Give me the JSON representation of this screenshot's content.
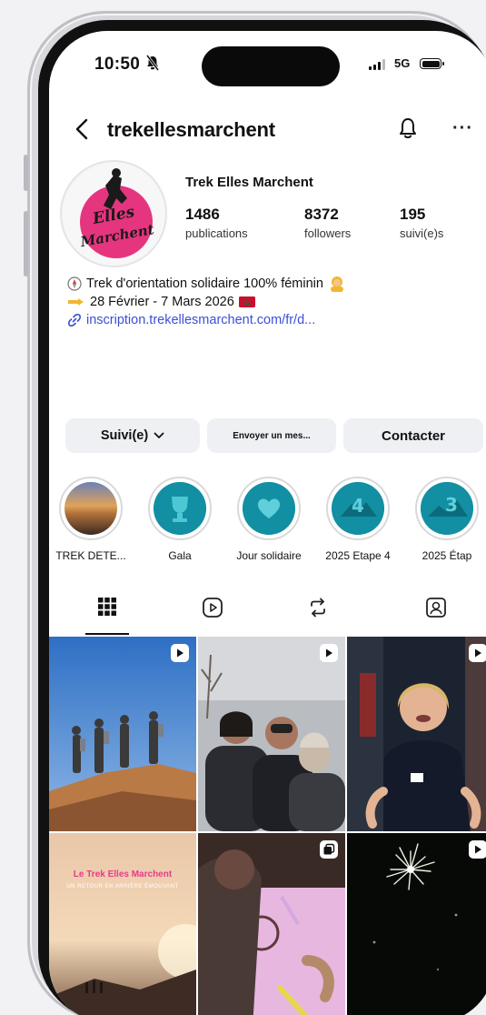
{
  "status_bar": {
    "time": "10:50",
    "network": "5G"
  },
  "header": {
    "username": "trekellesmarchent"
  },
  "profile": {
    "display_name": "Trek Elles Marchent",
    "avatar_text": "Elles Marchent",
    "stats": [
      {
        "value": "1486",
        "label": "publications"
      },
      {
        "value": "8372",
        "label": "followers"
      },
      {
        "value": "195",
        "label": "suivi(e)s"
      }
    ],
    "bio": {
      "line1": "Trek d'orientation solidaire 100% féminin",
      "line2": "28 Février - 7 Mars 2026",
      "link": "inscription.trekellesmarchent.com/fr/d..."
    }
  },
  "actions": {
    "follow": "Suivi(e)",
    "message": "Envoyer un mes...",
    "contact": "Contacter"
  },
  "highlights": [
    {
      "label": "TREK DETE..."
    },
    {
      "label": "Gala"
    },
    {
      "label": "Jour solidaire"
    },
    {
      "label": "2025 Etape 4"
    },
    {
      "label": "2025 Étap"
    }
  ],
  "tabs": [
    {
      "name": "grid-icon"
    },
    {
      "name": "reels-icon"
    },
    {
      "name": "reposts-icon"
    },
    {
      "name": "tagged-icon"
    }
  ],
  "grid": [
    {
      "name": "post-desert-hikers",
      "badge": "reel"
    },
    {
      "name": "post-women-winter",
      "badge": "reel"
    },
    {
      "name": "post-woman-speaking",
      "badge": "reel"
    },
    {
      "name": "post-sunrise-title",
      "badge": "none",
      "caption": "Le Trek Elles Marchent",
      "subcaption": "UN RETOUR EN ARRIÈRE ÉMOUVANT"
    },
    {
      "name": "post-map-reading",
      "badge": "carousel"
    },
    {
      "name": "post-fireworks",
      "badge": "reel"
    }
  ]
}
